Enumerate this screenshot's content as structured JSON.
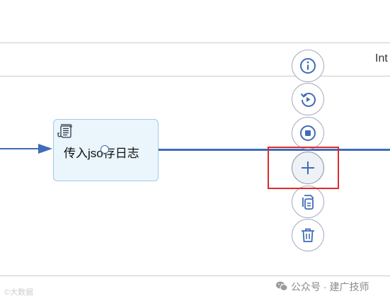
{
  "header": {
    "title_fragment": "Int"
  },
  "task": {
    "label": "传入jso存日志",
    "icon": "script-icon"
  },
  "toolbar": {
    "buttons": [
      {
        "name": "info-button",
        "icon": "info-icon"
      },
      {
        "name": "rollback-button",
        "icon": "rollback-icon"
      },
      {
        "name": "stop-button",
        "icon": "stop-icon"
      },
      {
        "name": "add-node-button",
        "icon": "plus-icon",
        "highlighted": true
      },
      {
        "name": "copy-button",
        "icon": "copy-icon"
      },
      {
        "name": "delete-button",
        "icon": "trash-icon"
      }
    ]
  },
  "colors": {
    "flow_line": "#3f6cb8",
    "task_bg": "#eaf5fc",
    "task_border": "#9ecbe8",
    "highlight": "#e0292b",
    "icon": "#3f6cb8"
  },
  "watermark": {
    "left": "©大数据",
    "right": "公众号 · 建广技师"
  }
}
